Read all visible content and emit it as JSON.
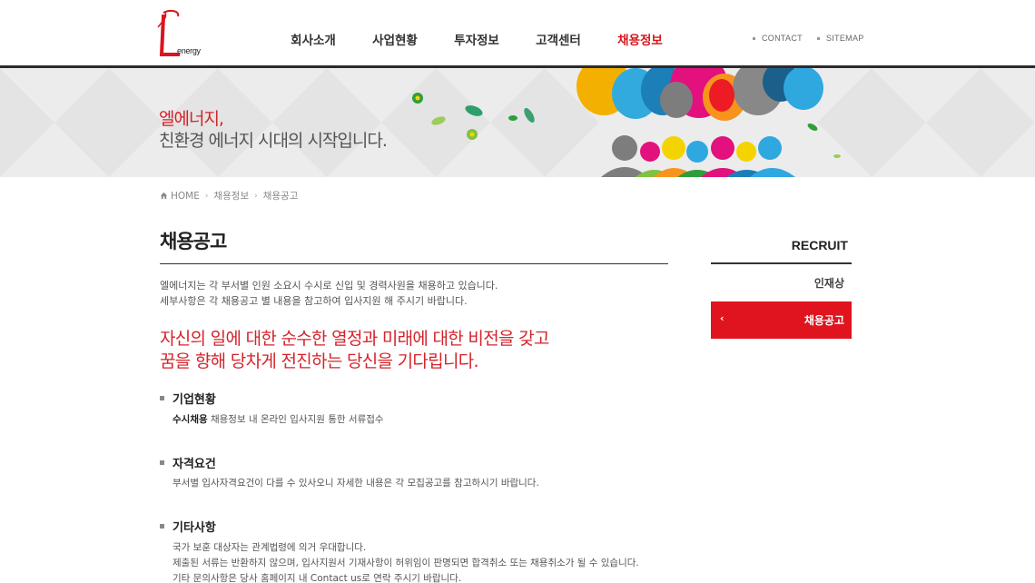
{
  "brand": {
    "logo_text": "energy"
  },
  "nav": {
    "items": [
      {
        "label": "회사소개"
      },
      {
        "label": "사업현황"
      },
      {
        "label": "투자정보"
      },
      {
        "label": "고객센터"
      },
      {
        "label": "채용정보"
      }
    ],
    "active_index": 4
  },
  "util": {
    "contact": "CONTACT",
    "sitemap": "SITEMAP"
  },
  "banner": {
    "slogan1": "엘에너지,",
    "slogan2": "친환경 에너지 시대의 시작입니다."
  },
  "breadcrumb": {
    "home": "HOME",
    "level1": "채용정보",
    "level2": "채용공고"
  },
  "main": {
    "title": "채용공고",
    "intro_line1": "엘에너지는 각 부서별 인원 소요시 수시로 신입 및 경력사원을 채용하고 있습니다.",
    "intro_line2": "세부사항은 각 채용공고 별 내용을 참고하여 입사지원 해 주시기 바랍니다.",
    "headline_line1": "자신의 일에 대한 순수한 열정과 미래에 대한 비전을 갖고",
    "headline_line2": "꿈을 향해 당차게 전진하는 당신을 기다립니다.",
    "sections": [
      {
        "title": "기업현황",
        "bold": "수시채용",
        "text": " 채용정보 내 온라인 입사지원 통한 서류접수"
      },
      {
        "title": "자격요건",
        "text": "부서별 입사자격요건이 다를 수 있사오니 자세한 내용은 각 모집공고를 참고하시기 바랍니다."
      },
      {
        "title": "기타사항",
        "line1": "국가 보훈 대상자는 관계법령에 의거 우대합니다.",
        "line2": "제출된 서류는 반환하지 않으며, 입사지원서 기재사항이 허위임이 판명되면 합격취소 또는 채용취소가 될 수 있습니다.",
        "line3": "기타 문의사항은 당사 홈페이지 내 Contact us로 연락 주시기 바랍니다."
      }
    ]
  },
  "sidebar": {
    "title": "RECRUIT",
    "items": [
      {
        "label": "인재상"
      },
      {
        "label": "채용공고"
      }
    ],
    "active_index": 1
  },
  "colors": {
    "accent": "#d9161d",
    "sidebar_active": "#e0141e"
  }
}
